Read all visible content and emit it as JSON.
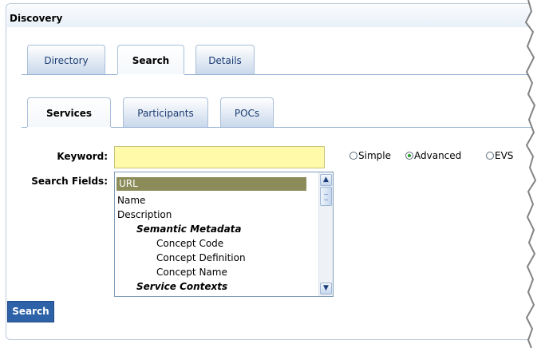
{
  "panel": {
    "title": "Discovery"
  },
  "tabs_main": [
    {
      "label": "Directory",
      "active": false
    },
    {
      "label": "Search",
      "active": true
    },
    {
      "label": "Details",
      "active": false
    }
  ],
  "tabs_sub": [
    {
      "label": "Services",
      "active": true
    },
    {
      "label": "Participants",
      "active": false
    },
    {
      "label": "POCs",
      "active": false
    }
  ],
  "form": {
    "keyword_label": "Keyword:",
    "keyword_value": "",
    "fields_label": "Search Fields:",
    "search_button": "Search"
  },
  "radios": [
    {
      "label": "Simple",
      "checked": false
    },
    {
      "label": "Advanced",
      "checked": true
    },
    {
      "label": "EVS",
      "checked": false
    }
  ],
  "search_fields": {
    "items": [
      {
        "label": "URL",
        "selected": true
      },
      {
        "label": "Name"
      },
      {
        "label": "Description"
      },
      {
        "label": "Semantic Metadata",
        "group": true
      },
      {
        "label": "Concept Code"
      },
      {
        "label": "Concept Definition"
      },
      {
        "label": "Concept Name"
      },
      {
        "label": "Service Contexts",
        "group": true
      }
    ]
  },
  "colors": {
    "tab_text": "#1b3b73",
    "button_bg": "#2d62a8",
    "keyword_bg": "#fffaa9",
    "selection_bg": "#8c8c5a"
  }
}
